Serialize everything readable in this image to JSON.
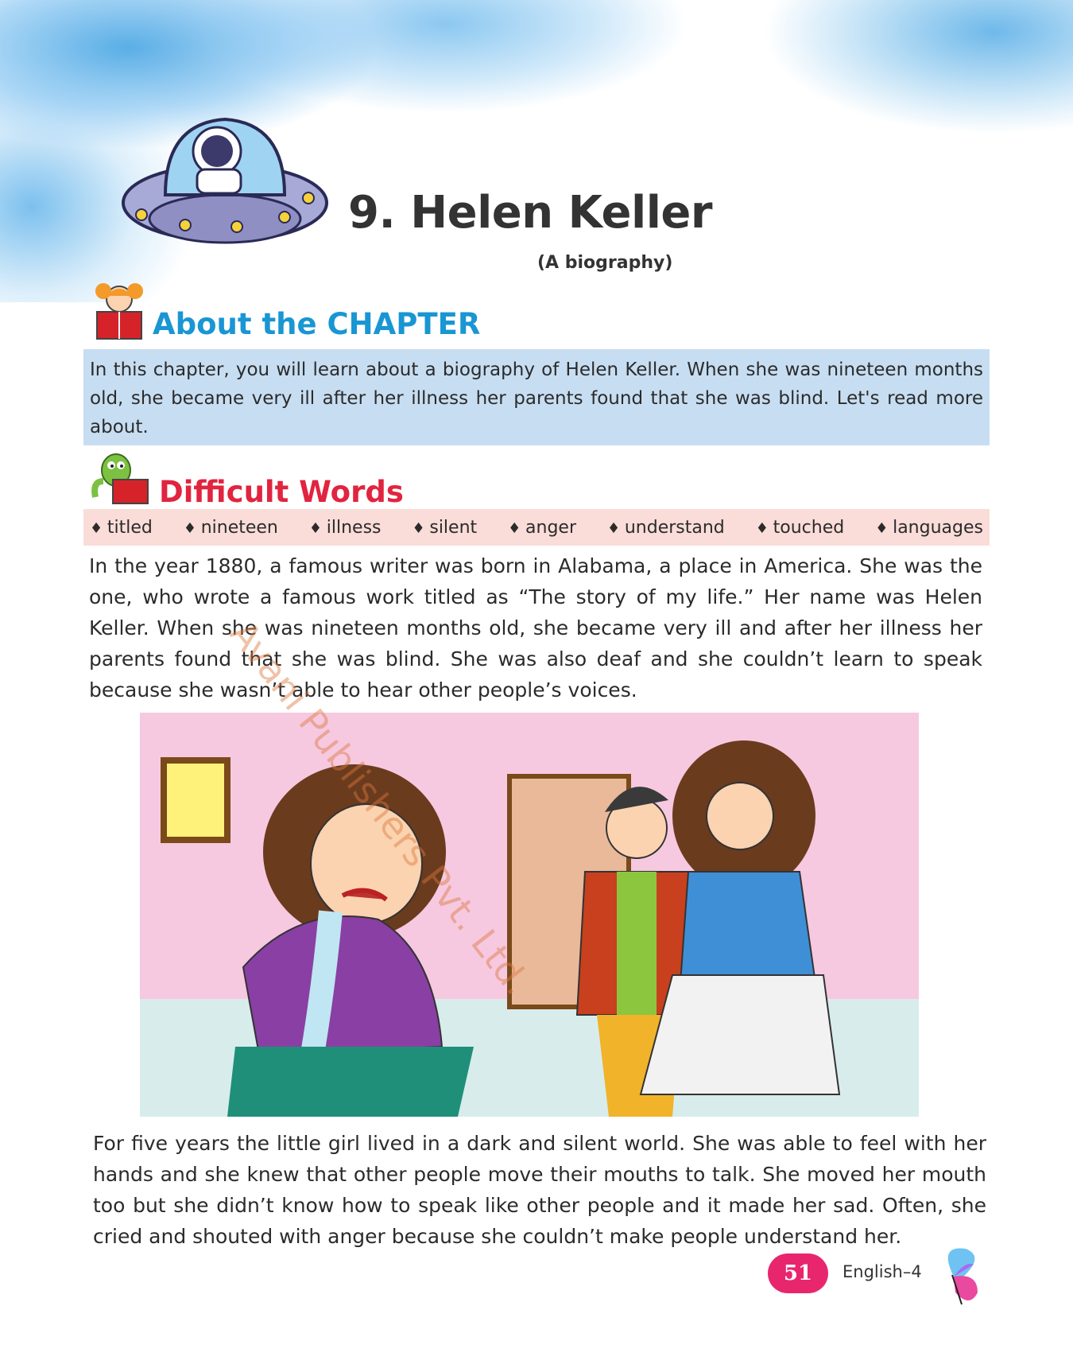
{
  "chapter": {
    "title": "9. Helen Keller",
    "subtitle": "(A biography)"
  },
  "about": {
    "heading": "About the CHAPTER",
    "text": "In this chapter, you will learn about a biography of Helen Keller. When she was nineteen months old, she became very ill after her illness her parents found that she was blind. Let's read more about."
  },
  "difficult_words": {
    "heading": "Difficult Words",
    "words": [
      "titled",
      "nineteen",
      "illness",
      "silent",
      "anger",
      "understand",
      "touched",
      "languages"
    ]
  },
  "body": {
    "paragraph1": "In the year 1880, a famous writer was born in Alabama, a place in America. She was the one, who wrote a famous work titled as “The story of my life.” Her name was Helen Keller. When she was nineteen months old, she became very ill and after her illness her parents found that she was blind. She was also deaf and she couldn’t learn to speak because she wasn’t able to hear other people’s voices.",
    "paragraph2": "For five years the little girl lived in a dark and silent world. She was able to feel with her hands and she knew that other people move their mouths to talk. She moved her mouth too but she didn’t know how to speak like other people and it made her sad. Often, she cried and shouted with anger because she couldn’t make people understand her."
  },
  "watermark": "Avani Publishers Pvt. Ltd.",
  "footer": {
    "page_number": "51",
    "book": "English–4"
  },
  "colors": {
    "about_heading": "#1996d3",
    "about_box": "#c7def2",
    "words_heading": "#e1243f",
    "words_box": "#fadcd8",
    "page_badge": "#e8266e"
  }
}
